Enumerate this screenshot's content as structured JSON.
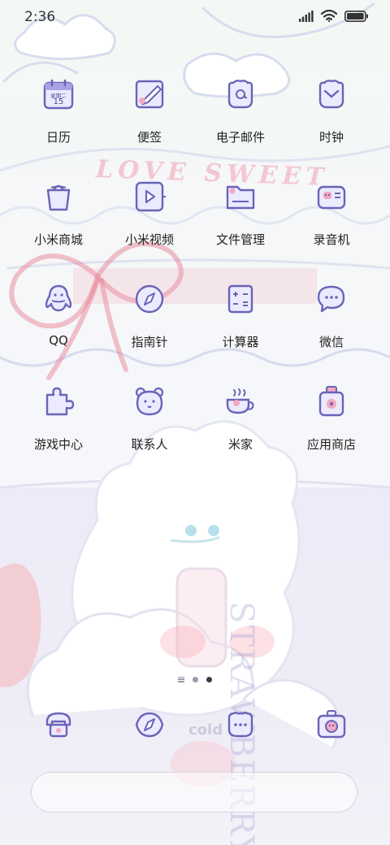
{
  "status_bar": {
    "time": "2:36",
    "icons": [
      "signal-icon",
      "wifi-icon",
      "battery-icon"
    ]
  },
  "colors": {
    "icon_stroke": "#6a64b8",
    "icon_fill": "#eceaff",
    "accent_pink": "#f2a8c0",
    "label_text": "#222222"
  },
  "wallpaper": {
    "text_love": "LOVE SWEET",
    "text_strawberry": "STRAWBERRY",
    "text_cup": "cold"
  },
  "apps": [
    {
      "label": "日历",
      "icon": "calendar-icon",
      "calendar_top": "星期二",
      "calendar_day": "15"
    },
    {
      "label": "便签",
      "icon": "notes-icon"
    },
    {
      "label": "电子邮件",
      "icon": "email-icon"
    },
    {
      "label": "时钟",
      "icon": "clock-icon"
    },
    {
      "label": "小米商城",
      "icon": "mi-store-icon"
    },
    {
      "label": "小米视频",
      "icon": "mi-video-icon"
    },
    {
      "label": "文件管理",
      "icon": "file-manager-icon"
    },
    {
      "label": "录音机",
      "icon": "recorder-icon"
    },
    {
      "label": "QQ",
      "icon": "qq-icon"
    },
    {
      "label": "指南针",
      "icon": "compass-icon"
    },
    {
      "label": "计算器",
      "icon": "calculator-icon"
    },
    {
      "label": "微信",
      "icon": "wechat-icon"
    },
    {
      "label": "游戏中心",
      "icon": "game-center-icon"
    },
    {
      "label": "联系人",
      "icon": "contacts-icon"
    },
    {
      "label": "米家",
      "icon": "mijia-icon"
    },
    {
      "label": "应用商店",
      "icon": "app-store-icon"
    }
  ],
  "page_indicator": {
    "pages": 3,
    "current": 3
  },
  "dock": [
    {
      "icon": "phone-icon"
    },
    {
      "icon": "browser-icon"
    },
    {
      "icon": "messages-icon"
    },
    {
      "icon": "camera-icon"
    }
  ]
}
